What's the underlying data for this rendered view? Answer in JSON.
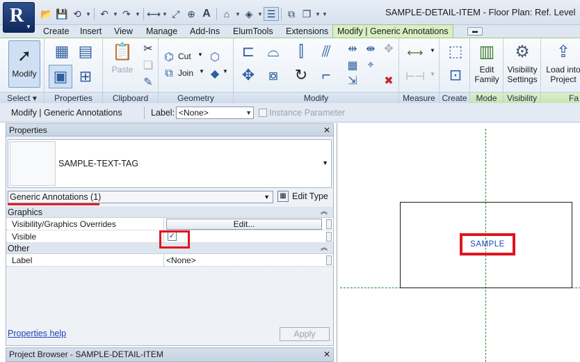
{
  "title": "SAMPLE-DETAIL-ITEM - Floor Plan: Ref. Level",
  "app_logo": "R",
  "qat_icons": [
    "open-icon",
    "save-icon",
    "sync-icon",
    "undo-icon",
    "redo-icon",
    "measure-icon",
    "align-dimension-icon",
    "tag-icon",
    "text-icon",
    "3d-view-icon",
    "section-icon",
    "thin-lines-icon",
    "close-hidden-icon",
    "switch-windows-icon",
    "customize-icon"
  ],
  "tabs": [
    "Create",
    "Insert",
    "View",
    "Manage",
    "Add-Ins",
    "ElumTools",
    "Extensions",
    "Modify | Generic Annotations"
  ],
  "ribbon": {
    "select": {
      "modify": "Modify",
      "label": "Select"
    },
    "properties": {
      "label": "Properties"
    },
    "clipboard": {
      "paste": "Paste",
      "label": "Clipboard"
    },
    "geometry": {
      "cut": "Cut",
      "join": "Join",
      "label": "Geometry"
    },
    "modify": {
      "label": "Modify"
    },
    "measure": {
      "label": "Measure"
    },
    "create": {
      "label": "Create"
    },
    "mode": {
      "edit_family_1": "Edit",
      "edit_family_2": "Family",
      "label": "Mode"
    },
    "visibility": {
      "settings_1": "Visibility",
      "settings_2": "Settings",
      "label": "Visibility"
    },
    "family": {
      "load_1": "Load into",
      "load_2": "Project",
      "label": "Fa"
    }
  },
  "options_bar": {
    "context": "Modify | Generic Annotations",
    "label_caption": "Label:",
    "label_value": "<None>",
    "instance_parameter": "Instance Parameter"
  },
  "properties": {
    "header": "Properties",
    "type_name": "SAMPLE-TEXT-TAG",
    "filter": "Generic Annotations (1)",
    "edit_type": "Edit Type",
    "groups": {
      "graphics": "Graphics",
      "other": "Other"
    },
    "rows": {
      "vis_overrides": "Visibility/Graphics Overrides",
      "edit_button": "Edit...",
      "visible": "Visible",
      "visible_checked": true,
      "label": "Label",
      "label_value": "<None>"
    },
    "help_link": "Properties help",
    "apply": "Apply"
  },
  "project_browser": "Project Browser - SAMPLE-DETAIL-ITEM",
  "canvas": {
    "tag_text": "SAMPLE"
  },
  "colors": {
    "highlight_red": "#e0141e",
    "ref_plane_green": "#1f8a2e",
    "tag_blue": "#1d47b5",
    "context_tab": "#d9efc4"
  }
}
